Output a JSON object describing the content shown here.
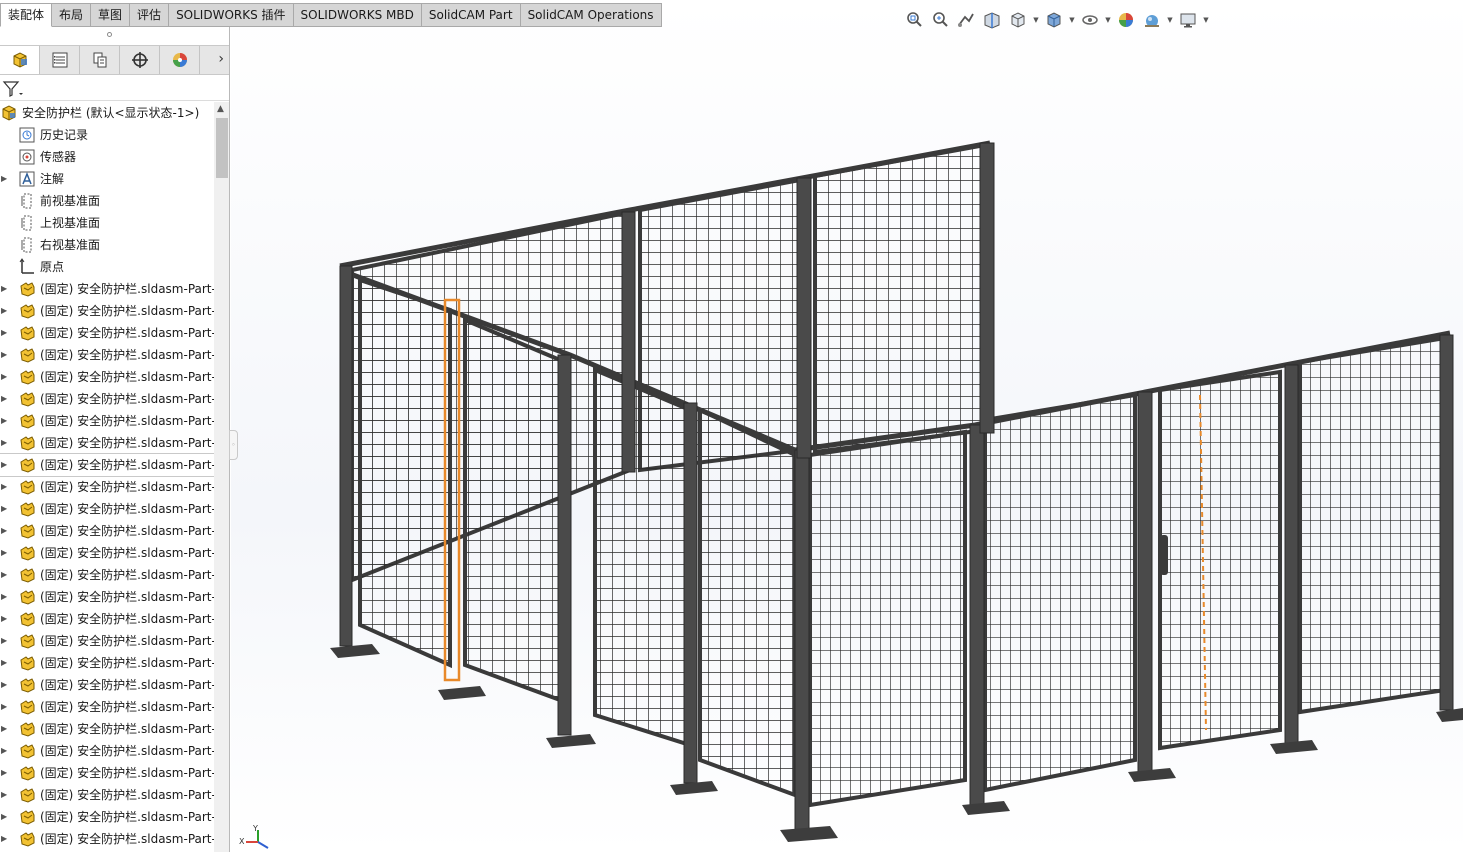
{
  "command_tabs": [
    "装配体",
    "布局",
    "草图",
    "评估",
    "SOLIDWORKS 插件",
    "SOLIDWORKS MBD",
    "SolidCAM Part",
    "SolidCAM Operations"
  ],
  "active_tab": "装配体",
  "heads_up_toolbar": [
    "zoom-to-fit-icon",
    "zoom-to-area-icon",
    "previous-view-icon",
    "section-view-icon",
    "view-orientation-icon",
    "display-style-icon",
    "hide-show-items-icon",
    "edit-appearance-icon",
    "apply-scene-icon",
    "view-settings-icon"
  ],
  "panel_tabs": [
    "feature-manager-icon",
    "property-manager-icon",
    "configuration-manager-icon",
    "dimxpert-manager-icon",
    "display-manager-icon"
  ],
  "tree": {
    "root": "安全防护栏 (默认<显示状态-1>)",
    "items": [
      {
        "label": "历史记录",
        "icon": "history-icon",
        "expandable": false
      },
      {
        "label": "传感器",
        "icon": "sensor-icon",
        "expandable": false
      },
      {
        "label": "注解",
        "icon": "annotation-icon",
        "expandable": true
      },
      {
        "label": "前视基准面",
        "icon": "plane-icon",
        "expandable": false
      },
      {
        "label": "上视基准面",
        "icon": "plane-icon",
        "expandable": false
      },
      {
        "label": "右视基准面",
        "icon": "plane-icon",
        "expandable": false
      },
      {
        "label": "原点",
        "icon": "origin-icon",
        "expandable": false
      }
    ],
    "part_label": "(固定) 安全防护栏.sldasm-Part-",
    "part_count": 26,
    "selected_part_index": 8
  },
  "triad": {
    "x": "X",
    "y": "Y"
  }
}
